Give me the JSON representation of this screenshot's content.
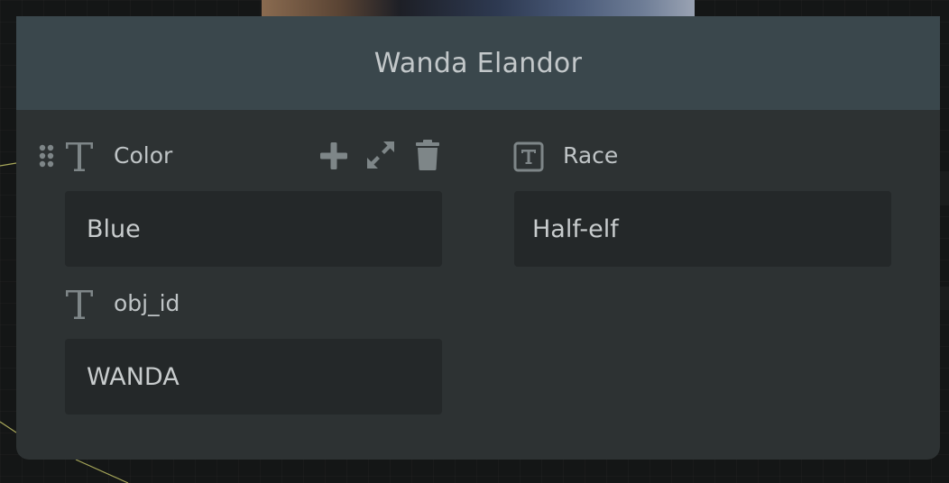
{
  "card": {
    "title": "Wanda Elandor"
  },
  "fields": [
    {
      "label": "Color",
      "value": "Blue",
      "type_icon": "text-type-icon"
    },
    {
      "label": "Race",
      "value": "Half-elf",
      "type_icon": "text-box-type-icon"
    },
    {
      "label": "obj_id",
      "value": "WANDA",
      "type_icon": "text-type-icon"
    }
  ],
  "field_actions": [
    "drag-handle-icon",
    "add-icon",
    "expand-icon",
    "trash-icon"
  ],
  "colors": {
    "header_bg": "#3a474c",
    "card_bg": "#2d3233",
    "input_bg": "#242829",
    "icon": "#7e8688",
    "text": "#c3c8ca"
  }
}
